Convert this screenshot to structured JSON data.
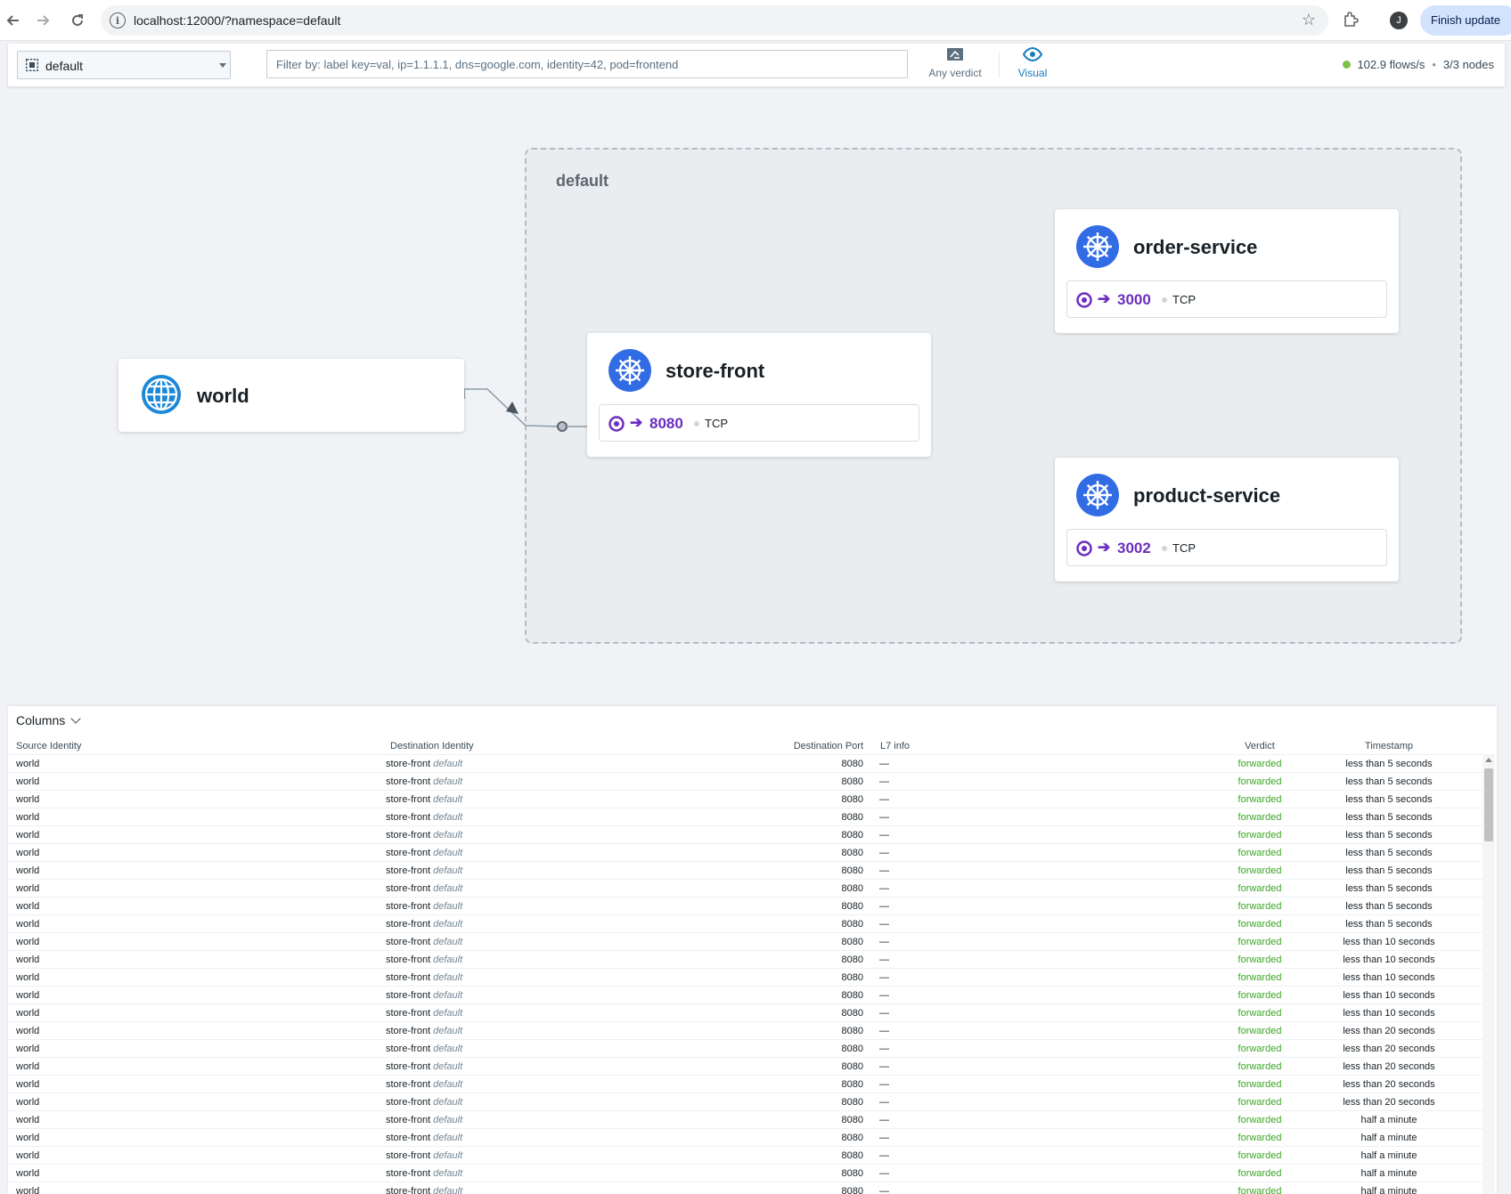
{
  "browser": {
    "url": "localhost:12000/?namespace=default",
    "update_label": "Finish update",
    "avatar_initial": "J"
  },
  "topbar": {
    "namespace": "default",
    "filter_placeholder": "Filter by: label key=val, ip=1.1.1.1, dns=google.com, identity=42, pod=frontend",
    "verdict_label": "Any verdict",
    "visual_label": "Visual",
    "flows_rate": "102.9 flows/s",
    "separator": "•",
    "nodes": "3/3 nodes",
    "status_color": "#7cc243"
  },
  "map": {
    "namespace_title": "default",
    "world": {
      "title": "world"
    },
    "store_front": {
      "title": "store-front",
      "port": "8080",
      "protocol": "TCP"
    },
    "order_service": {
      "title": "order-service",
      "port": "3000",
      "protocol": "TCP"
    },
    "product_service": {
      "title": "product-service",
      "port": "3002",
      "protocol": "TCP"
    },
    "arrow_glyph": "➔"
  },
  "flows": {
    "columns_label": "Columns",
    "headers": {
      "source": "Source Identity",
      "destination": "Destination Identity",
      "port": "Destination Port",
      "l7": "L7 info",
      "verdict": "Verdict",
      "timestamp": "Timestamp"
    },
    "rows": [
      {
        "src": "world",
        "dst": "store-front",
        "dst_ns": "default",
        "port": "8080",
        "l7": "—",
        "verdict": "forwarded",
        "ts": "less than 5 seconds"
      },
      {
        "src": "world",
        "dst": "store-front",
        "dst_ns": "default",
        "port": "8080",
        "l7": "—",
        "verdict": "forwarded",
        "ts": "less than 5 seconds"
      },
      {
        "src": "world",
        "dst": "store-front",
        "dst_ns": "default",
        "port": "8080",
        "l7": "—",
        "verdict": "forwarded",
        "ts": "less than 5 seconds"
      },
      {
        "src": "world",
        "dst": "store-front",
        "dst_ns": "default",
        "port": "8080",
        "l7": "—",
        "verdict": "forwarded",
        "ts": "less than 5 seconds"
      },
      {
        "src": "world",
        "dst": "store-front",
        "dst_ns": "default",
        "port": "8080",
        "l7": "—",
        "verdict": "forwarded",
        "ts": "less than 5 seconds"
      },
      {
        "src": "world",
        "dst": "store-front",
        "dst_ns": "default",
        "port": "8080",
        "l7": "—",
        "verdict": "forwarded",
        "ts": "less than 5 seconds"
      },
      {
        "src": "world",
        "dst": "store-front",
        "dst_ns": "default",
        "port": "8080",
        "l7": "—",
        "verdict": "forwarded",
        "ts": "less than 5 seconds"
      },
      {
        "src": "world",
        "dst": "store-front",
        "dst_ns": "default",
        "port": "8080",
        "l7": "—",
        "verdict": "forwarded",
        "ts": "less than 5 seconds"
      },
      {
        "src": "world",
        "dst": "store-front",
        "dst_ns": "default",
        "port": "8080",
        "l7": "—",
        "verdict": "forwarded",
        "ts": "less than 5 seconds"
      },
      {
        "src": "world",
        "dst": "store-front",
        "dst_ns": "default",
        "port": "8080",
        "l7": "—",
        "verdict": "forwarded",
        "ts": "less than 5 seconds"
      },
      {
        "src": "world",
        "dst": "store-front",
        "dst_ns": "default",
        "port": "8080",
        "l7": "—",
        "verdict": "forwarded",
        "ts": "less than 10 seconds"
      },
      {
        "src": "world",
        "dst": "store-front",
        "dst_ns": "default",
        "port": "8080",
        "l7": "—",
        "verdict": "forwarded",
        "ts": "less than 10 seconds"
      },
      {
        "src": "world",
        "dst": "store-front",
        "dst_ns": "default",
        "port": "8080",
        "l7": "—",
        "verdict": "forwarded",
        "ts": "less than 10 seconds"
      },
      {
        "src": "world",
        "dst": "store-front",
        "dst_ns": "default",
        "port": "8080",
        "l7": "—",
        "verdict": "forwarded",
        "ts": "less than 10 seconds"
      },
      {
        "src": "world",
        "dst": "store-front",
        "dst_ns": "default",
        "port": "8080",
        "l7": "—",
        "verdict": "forwarded",
        "ts": "less than 10 seconds"
      },
      {
        "src": "world",
        "dst": "store-front",
        "dst_ns": "default",
        "port": "8080",
        "l7": "—",
        "verdict": "forwarded",
        "ts": "less than 20 seconds"
      },
      {
        "src": "world",
        "dst": "store-front",
        "dst_ns": "default",
        "port": "8080",
        "l7": "—",
        "verdict": "forwarded",
        "ts": "less than 20 seconds"
      },
      {
        "src": "world",
        "dst": "store-front",
        "dst_ns": "default",
        "port": "8080",
        "l7": "—",
        "verdict": "forwarded",
        "ts": "less than 20 seconds"
      },
      {
        "src": "world",
        "dst": "store-front",
        "dst_ns": "default",
        "port": "8080",
        "l7": "—",
        "verdict": "forwarded",
        "ts": "less than 20 seconds"
      },
      {
        "src": "world",
        "dst": "store-front",
        "dst_ns": "default",
        "port": "8080",
        "l7": "—",
        "verdict": "forwarded",
        "ts": "less than 20 seconds"
      },
      {
        "src": "world",
        "dst": "store-front",
        "dst_ns": "default",
        "port": "8080",
        "l7": "—",
        "verdict": "forwarded",
        "ts": "half a minute"
      },
      {
        "src": "world",
        "dst": "store-front",
        "dst_ns": "default",
        "port": "8080",
        "l7": "—",
        "verdict": "forwarded",
        "ts": "half a minute"
      },
      {
        "src": "world",
        "dst": "store-front",
        "dst_ns": "default",
        "port": "8080",
        "l7": "—",
        "verdict": "forwarded",
        "ts": "half a minute"
      },
      {
        "src": "world",
        "dst": "store-front",
        "dst_ns": "default",
        "port": "8080",
        "l7": "—",
        "verdict": "forwarded",
        "ts": "half a minute"
      },
      {
        "src": "world",
        "dst": "store-front",
        "dst_ns": "default",
        "port": "8080",
        "l7": "—",
        "verdict": "forwarded",
        "ts": "half a minute"
      }
    ]
  },
  "icons": {
    "back": "arrow-left-icon",
    "forward": "arrow-right-icon",
    "reload": "reload-icon",
    "world": "globe-icon",
    "service": "kubernetes-icon",
    "endpoint": "target-icon"
  },
  "colors": {
    "accent": "#137cbd",
    "port_purple": "#6c2ec0",
    "verdict_forwarded": "#3ba525",
    "k8s_blue": "#326ce5",
    "globe_blue": "#1c88d7"
  }
}
